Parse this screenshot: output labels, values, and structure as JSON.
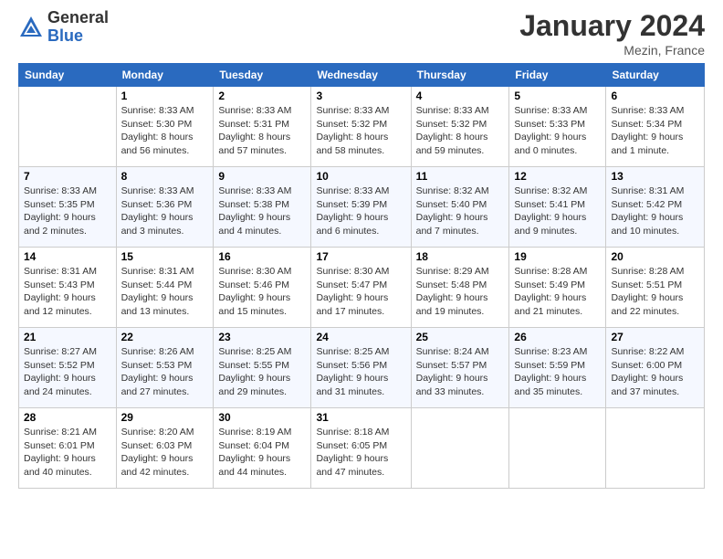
{
  "header": {
    "logo_general": "General",
    "logo_blue": "Blue",
    "month": "January 2024",
    "location": "Mezin, France"
  },
  "weekdays": [
    "Sunday",
    "Monday",
    "Tuesday",
    "Wednesday",
    "Thursday",
    "Friday",
    "Saturday"
  ],
  "weeks": [
    [
      {
        "day": "",
        "sunrise": "",
        "sunset": "",
        "daylight": ""
      },
      {
        "day": "1",
        "sunrise": "Sunrise: 8:33 AM",
        "sunset": "Sunset: 5:30 PM",
        "daylight": "Daylight: 8 hours and 56 minutes."
      },
      {
        "day": "2",
        "sunrise": "Sunrise: 8:33 AM",
        "sunset": "Sunset: 5:31 PM",
        "daylight": "Daylight: 8 hours and 57 minutes."
      },
      {
        "day": "3",
        "sunrise": "Sunrise: 8:33 AM",
        "sunset": "Sunset: 5:32 PM",
        "daylight": "Daylight: 8 hours and 58 minutes."
      },
      {
        "day": "4",
        "sunrise": "Sunrise: 8:33 AM",
        "sunset": "Sunset: 5:32 PM",
        "daylight": "Daylight: 8 hours and 59 minutes."
      },
      {
        "day": "5",
        "sunrise": "Sunrise: 8:33 AM",
        "sunset": "Sunset: 5:33 PM",
        "daylight": "Daylight: 9 hours and 0 minutes."
      },
      {
        "day": "6",
        "sunrise": "Sunrise: 8:33 AM",
        "sunset": "Sunset: 5:34 PM",
        "daylight": "Daylight: 9 hours and 1 minute."
      }
    ],
    [
      {
        "day": "7",
        "sunrise": "Sunrise: 8:33 AM",
        "sunset": "Sunset: 5:35 PM",
        "daylight": "Daylight: 9 hours and 2 minutes."
      },
      {
        "day": "8",
        "sunrise": "Sunrise: 8:33 AM",
        "sunset": "Sunset: 5:36 PM",
        "daylight": "Daylight: 9 hours and 3 minutes."
      },
      {
        "day": "9",
        "sunrise": "Sunrise: 8:33 AM",
        "sunset": "Sunset: 5:38 PM",
        "daylight": "Daylight: 9 hours and 4 minutes."
      },
      {
        "day": "10",
        "sunrise": "Sunrise: 8:33 AM",
        "sunset": "Sunset: 5:39 PM",
        "daylight": "Daylight: 9 hours and 6 minutes."
      },
      {
        "day": "11",
        "sunrise": "Sunrise: 8:32 AM",
        "sunset": "Sunset: 5:40 PM",
        "daylight": "Daylight: 9 hours and 7 minutes."
      },
      {
        "day": "12",
        "sunrise": "Sunrise: 8:32 AM",
        "sunset": "Sunset: 5:41 PM",
        "daylight": "Daylight: 9 hours and 9 minutes."
      },
      {
        "day": "13",
        "sunrise": "Sunrise: 8:31 AM",
        "sunset": "Sunset: 5:42 PM",
        "daylight": "Daylight: 9 hours and 10 minutes."
      }
    ],
    [
      {
        "day": "14",
        "sunrise": "Sunrise: 8:31 AM",
        "sunset": "Sunset: 5:43 PM",
        "daylight": "Daylight: 9 hours and 12 minutes."
      },
      {
        "day": "15",
        "sunrise": "Sunrise: 8:31 AM",
        "sunset": "Sunset: 5:44 PM",
        "daylight": "Daylight: 9 hours and 13 minutes."
      },
      {
        "day": "16",
        "sunrise": "Sunrise: 8:30 AM",
        "sunset": "Sunset: 5:46 PM",
        "daylight": "Daylight: 9 hours and 15 minutes."
      },
      {
        "day": "17",
        "sunrise": "Sunrise: 8:30 AM",
        "sunset": "Sunset: 5:47 PM",
        "daylight": "Daylight: 9 hours and 17 minutes."
      },
      {
        "day": "18",
        "sunrise": "Sunrise: 8:29 AM",
        "sunset": "Sunset: 5:48 PM",
        "daylight": "Daylight: 9 hours and 19 minutes."
      },
      {
        "day": "19",
        "sunrise": "Sunrise: 8:28 AM",
        "sunset": "Sunset: 5:49 PM",
        "daylight": "Daylight: 9 hours and 21 minutes."
      },
      {
        "day": "20",
        "sunrise": "Sunrise: 8:28 AM",
        "sunset": "Sunset: 5:51 PM",
        "daylight": "Daylight: 9 hours and 22 minutes."
      }
    ],
    [
      {
        "day": "21",
        "sunrise": "Sunrise: 8:27 AM",
        "sunset": "Sunset: 5:52 PM",
        "daylight": "Daylight: 9 hours and 24 minutes."
      },
      {
        "day": "22",
        "sunrise": "Sunrise: 8:26 AM",
        "sunset": "Sunset: 5:53 PM",
        "daylight": "Daylight: 9 hours and 27 minutes."
      },
      {
        "day": "23",
        "sunrise": "Sunrise: 8:25 AM",
        "sunset": "Sunset: 5:55 PM",
        "daylight": "Daylight: 9 hours and 29 minutes."
      },
      {
        "day": "24",
        "sunrise": "Sunrise: 8:25 AM",
        "sunset": "Sunset: 5:56 PM",
        "daylight": "Daylight: 9 hours and 31 minutes."
      },
      {
        "day": "25",
        "sunrise": "Sunrise: 8:24 AM",
        "sunset": "Sunset: 5:57 PM",
        "daylight": "Daylight: 9 hours and 33 minutes."
      },
      {
        "day": "26",
        "sunrise": "Sunrise: 8:23 AM",
        "sunset": "Sunset: 5:59 PM",
        "daylight": "Daylight: 9 hours and 35 minutes."
      },
      {
        "day": "27",
        "sunrise": "Sunrise: 8:22 AM",
        "sunset": "Sunset: 6:00 PM",
        "daylight": "Daylight: 9 hours and 37 minutes."
      }
    ],
    [
      {
        "day": "28",
        "sunrise": "Sunrise: 8:21 AM",
        "sunset": "Sunset: 6:01 PM",
        "daylight": "Daylight: 9 hours and 40 minutes."
      },
      {
        "day": "29",
        "sunrise": "Sunrise: 8:20 AM",
        "sunset": "Sunset: 6:03 PM",
        "daylight": "Daylight: 9 hours and 42 minutes."
      },
      {
        "day": "30",
        "sunrise": "Sunrise: 8:19 AM",
        "sunset": "Sunset: 6:04 PM",
        "daylight": "Daylight: 9 hours and 44 minutes."
      },
      {
        "day": "31",
        "sunrise": "Sunrise: 8:18 AM",
        "sunset": "Sunset: 6:05 PM",
        "daylight": "Daylight: 9 hours and 47 minutes."
      },
      {
        "day": "",
        "sunrise": "",
        "sunset": "",
        "daylight": ""
      },
      {
        "day": "",
        "sunrise": "",
        "sunset": "",
        "daylight": ""
      },
      {
        "day": "",
        "sunrise": "",
        "sunset": "",
        "daylight": ""
      }
    ]
  ]
}
